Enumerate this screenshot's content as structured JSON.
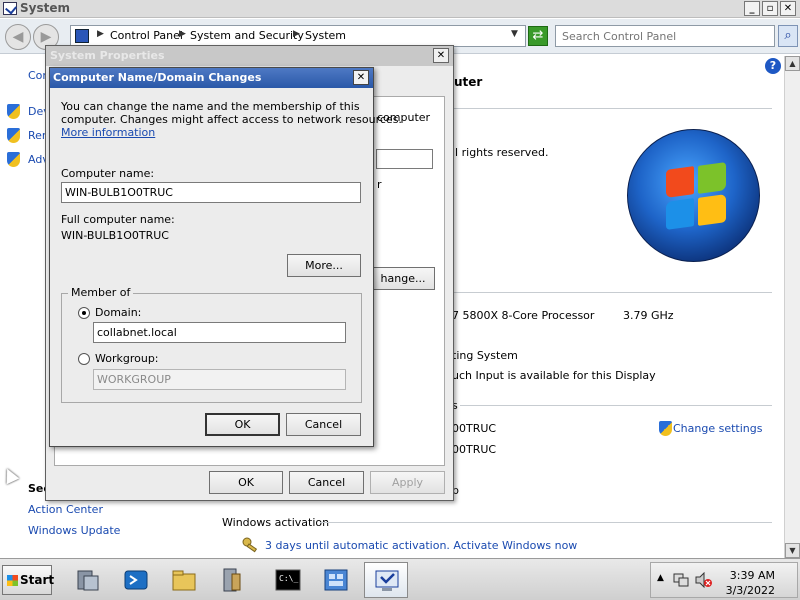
{
  "window": {
    "title": "System",
    "min_label": "_",
    "max_label": "▫",
    "close_label": "✕"
  },
  "address": {
    "crumbs": [
      "Control Panel",
      "System and Security",
      "System"
    ],
    "search_placeholder": "Search Control Panel"
  },
  "left_pane": {
    "home_link_partial": "Con",
    "links": [
      "Dev",
      "Ren",
      "Adv"
    ],
    "see_also_partial": "Sec",
    "bottom_links": [
      "Action Center",
      "Windows Update"
    ]
  },
  "right_pane": {
    "header_partial": "uter",
    "copyright_partial": "ll rights reserved.",
    "processor_partial": "7 5800X 8-Core Processor",
    "processor_speed": "3.79 GHz",
    "system_type_partial": "ting System",
    "touch_partial": "uch Input is available for this Display",
    "section_partial": "s",
    "computer_name_partial": "00TRUC",
    "full_name_partial": "00TRUC",
    "change_settings": "Change settings",
    "workgroup_partial": "p",
    "windows_activation_label": "Windows activation",
    "activation_text": "3 days until automatic activation. Activate Windows now"
  },
  "system_properties": {
    "title": "System Properties",
    "partial_computer": "computer",
    "partial_r": "r",
    "change_button_partial": "hange...",
    "ok": "OK",
    "cancel": "Cancel",
    "apply": "Apply"
  },
  "domain_dialog": {
    "title": "Computer Name/Domain Changes",
    "intro_line1": "You can change the name and the membership of this",
    "intro_line2": "computer. Changes might affect access to network resources.",
    "more_info_link": "More information",
    "computer_name_label": "Computer name:",
    "computer_name_value": "WIN-BULB1O0TRUC",
    "full_name_label": "Full computer name:",
    "full_name_value": "WIN-BULB1O0TRUC",
    "more_button": "More...",
    "member_of": "Member of",
    "domain_label": "Domain:",
    "domain_value": "collabnet.local",
    "domain_selected": true,
    "workgroup_label": "Workgroup:",
    "workgroup_value": "WORKGROUP",
    "ok": "OK",
    "cancel": "Cancel"
  },
  "taskbar": {
    "start_label": "Start",
    "clock_time": "3:39 AM",
    "clock_date": "3/3/2022"
  }
}
